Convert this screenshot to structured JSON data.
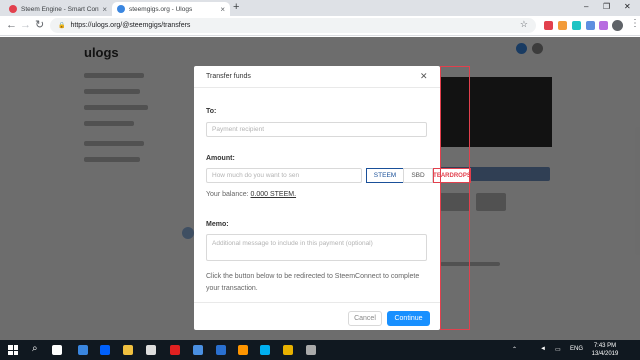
{
  "browser": {
    "tabs": [
      {
        "title": "Steem Engine - Smart Contracts"
      },
      {
        "title": "steemgigs.org - Ulogs"
      }
    ],
    "url": "https://ulogs.org/@steemgigs/transfers"
  },
  "page": {
    "logo": "ulogs"
  },
  "modal": {
    "title": "Transfer funds",
    "to_label": "To:",
    "to_placeholder": "Payment recipient",
    "amount_label": "Amount:",
    "amount_placeholder": "How much do you want to sen",
    "currencies": [
      "STEEM",
      "SBD",
      "TEARDROPS"
    ],
    "selected_currency": "STEEM",
    "balance_label": "Your balance:",
    "balance_value": "0.000 STEEM.",
    "memo_label": "Memo:",
    "memo_placeholder": "Additional message to include in this payment (optional)",
    "note": "Click the button below to be redirected to SteemConnect to complete your transaction.",
    "cancel_label": "Cancel",
    "continue_label": "Continue"
  },
  "taskbar": {
    "language": "ENG",
    "time": "7:43 PM",
    "date": "13/4/2019"
  },
  "colors": {
    "primary": "#1890ff",
    "steem_blue": "#1a5099",
    "highlight_red": "#e2404d"
  }
}
